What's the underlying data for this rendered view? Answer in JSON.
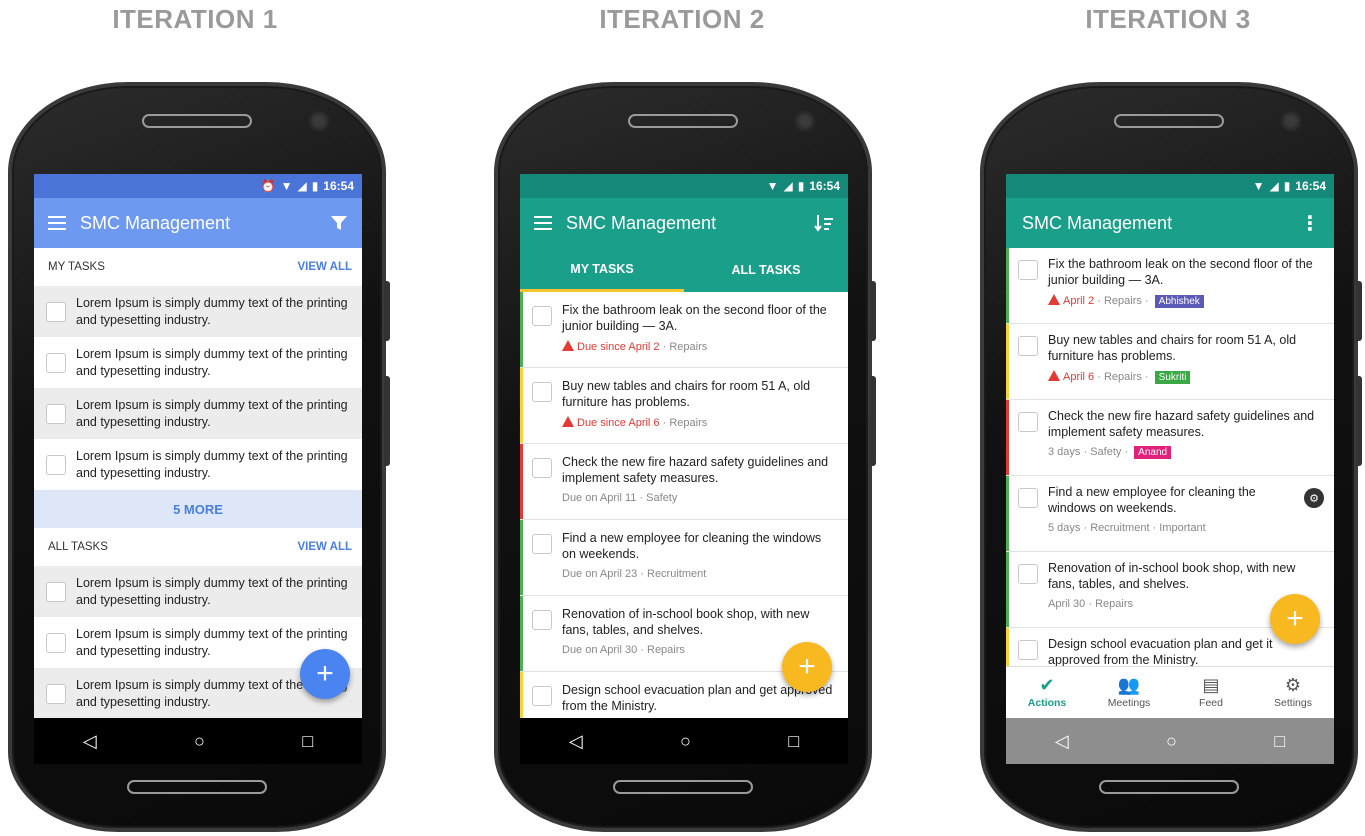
{
  "titles": [
    "ITERATION 1",
    "ITERATION 2",
    "ITERATION 3"
  ],
  "colors": {
    "blue": "#6d99f0",
    "blue_status": "#4a74d8",
    "teal": "#1aa08a",
    "teal_status": "#14897a",
    "amber": "#f7b820",
    "green": "#4caf50",
    "yellow": "#f7d23a",
    "red": "#e53935"
  },
  "status_time": "16:54",
  "app_title": "SMC Management",
  "iter1": {
    "my_tasks": "MY TASKS",
    "all_tasks": "ALL TASKS",
    "view_all": "VIEW ALL",
    "more": "5 MORE",
    "item_text": "Lorem Ipsum is simply dummy text of the printing and typesetting industry.",
    "fab": "+"
  },
  "iter2": {
    "tabs": [
      "MY TASKS",
      "ALL TASKS"
    ],
    "tasks": [
      {
        "text": "Fix the bathroom leak on the second floor of the junior building — 3A.",
        "due": "Due since April 2",
        "cat": " · Repairs",
        "overdue": true,
        "edge": "#4caf50"
      },
      {
        "text": "Buy new tables and chairs for room 51 A, old furniture has problems.",
        "due": "Due since April 6",
        "cat": " · Repairs",
        "overdue": true,
        "edge": "#f7d23a"
      },
      {
        "text": "Check the new fire hazard safety guidelines and implement safety measures.",
        "due": "Due on April 11",
        "cat": " · Safety",
        "overdue": false,
        "edge": "#e53935"
      },
      {
        "text": "Find a new employee for cleaning the windows on weekends.",
        "due": "Due on April 23",
        "cat": " · Recruitment",
        "overdue": false,
        "edge": "#4caf50"
      },
      {
        "text": "Renovation of in-school book shop, with new fans, tables, and shelves.",
        "due": "Due on April 30",
        "cat": " · Repairs",
        "overdue": false,
        "edge": "#4caf50"
      },
      {
        "text": "Design school evacuation plan and get approved from the Ministry.",
        "due": "",
        "cat": "",
        "overdue": false,
        "edge": "#f7d23a"
      }
    ],
    "fab": "+"
  },
  "iter3": {
    "tasks": [
      {
        "text": "Fix the bathroom leak on the second floor of the junior building — 3A.",
        "due": "April 2",
        "cat": " · Repairs · ",
        "tag": "Abhishek",
        "tag_color": "#5c5ab8",
        "overdue": true,
        "edge": "#4caf50"
      },
      {
        "text": "Buy new tables and chairs for room 51 A, old furniture has problems.",
        "due": "April 6",
        "cat": " · Repairs · ",
        "tag": "Sukriti",
        "tag_color": "#3aa845",
        "overdue": true,
        "edge": "#f7d23a"
      },
      {
        "text": "Check the new fire hazard safety guidelines and implement safety measures.",
        "due": "3 days",
        "cat": " · Safety · ",
        "tag": "Anand",
        "tag_color": "#e0207a",
        "overdue": false,
        "edge": "#e53935"
      },
      {
        "text": "Find a new employee for cleaning the windows on weekends.",
        "due": "5 days",
        "cat": " · Recruitment · Important",
        "tag": "",
        "tag_color": "",
        "overdue": false,
        "edge": "#4caf50"
      },
      {
        "text": "Renovation of in-school book shop, with new fans, tables, and shelves.",
        "due": "April 30",
        "cat": " · Repairs",
        "tag": "",
        "tag_color": "",
        "overdue": false,
        "edge": "#4caf50"
      },
      {
        "text": "Design school evacuation plan and get it approved from the Ministry.",
        "due": "",
        "cat": "",
        "tag": "",
        "tag_color": "",
        "overdue": false,
        "edge": "#f7d23a"
      }
    ],
    "nav": [
      "Actions",
      "Meetings",
      "Feed",
      "Settings"
    ],
    "fab": "+"
  }
}
